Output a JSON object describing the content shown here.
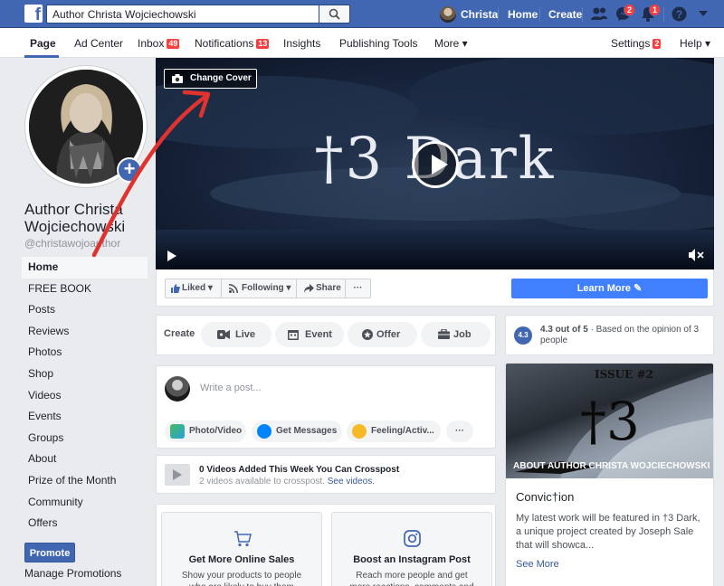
{
  "topbar": {
    "search_value": "Author Christa Wojciechowski",
    "user_name": "Christa",
    "home": "Home",
    "create": "Create",
    "messages_badge": "2",
    "notifications_badge": "1"
  },
  "pagenav": {
    "page": "Page",
    "ad_center": "Ad Center",
    "inbox": "Inbox",
    "inbox_badge": "49",
    "notifications": "Notifications",
    "notifications_badge": "13",
    "insights": "Insights",
    "publishing_tools": "Publishing Tools",
    "more": "More ▾",
    "settings": "Settings",
    "settings_badge": "2",
    "help": "Help ▾"
  },
  "profile": {
    "name": "Author Christa Wojciechowski",
    "handle": "@christawojoauthor"
  },
  "leftnav": {
    "items": [
      "Home",
      "FREE BOOK",
      "Posts",
      "Reviews",
      "Photos",
      "Shop",
      "Videos",
      "Events",
      "Groups",
      "About",
      "Prize of the Month",
      "Community",
      "Offers"
    ],
    "promote": "Promote",
    "manage_promotions": "Manage Promotions"
  },
  "cover": {
    "change_cover": "Change Cover",
    "title": "†3 Dark"
  },
  "actions": {
    "liked": "Liked",
    "following": "Following",
    "share": "Share",
    "more": "···",
    "learn_more": "Learn More"
  },
  "create": {
    "label": "Create",
    "live": "Live",
    "event": "Event",
    "offer": "Offer",
    "job": "Job"
  },
  "composer": {
    "placeholder": "Write a post...",
    "photo_video": "Photo/Video",
    "get_messages": "Get Messages",
    "feeling": "Feeling/Activ...",
    "more": "···"
  },
  "crosspost": {
    "title": "0 Videos Added This Week You Can Crosspost",
    "subtitle": "2 videos available to crosspost.",
    "link": "See videos."
  },
  "promos": [
    {
      "title": "Get More Online Sales",
      "desc": "Show your products to people who are likely to buy them"
    },
    {
      "title": "Boost an Instagram Post",
      "desc": "Reach more people and get more reactions, comments and shares"
    }
  ],
  "rating": {
    "score_badge": "4.3",
    "score": "4.3 out of 5",
    "text": " · Based on the opinion of 3 people"
  },
  "about": {
    "caption": "ABOUT AUTHOR CHRISTA WOJCIECHOWSKI",
    "issue": "ISSUE #2",
    "image_title": "†3",
    "heading": "Convic†ion",
    "body": "My latest work will be featured in †3 Dark, a unique project created by Joseph Sale that will showca...",
    "see_more": "See More"
  },
  "colors": {
    "brand": "#4267b2",
    "learn_more": "#4080ff",
    "badge": "#fa3e3e",
    "annotation_arrow": "#e0322e"
  }
}
